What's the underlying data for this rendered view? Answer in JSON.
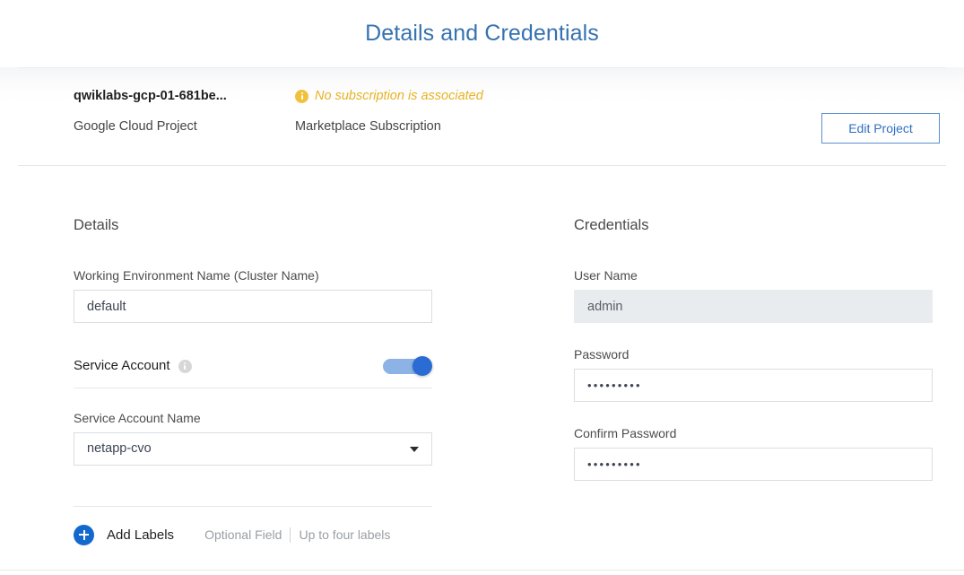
{
  "page": {
    "title": "Details and Credentials"
  },
  "project_band": {
    "project_name": "qwiklabs-gcp-01-681be...",
    "project_caption": "Google Cloud Project",
    "subscription_warning": "No subscription is associated",
    "subscription_caption": "Marketplace Subscription",
    "warning_icon": "info-icon",
    "edit_button_label": "Edit Project",
    "warning_color": "#e8b224",
    "accent_color": "#2f6fc0"
  },
  "details": {
    "section_title": "Details",
    "working_env": {
      "label": "Working Environment Name (Cluster Name)",
      "value": "default",
      "placeholder": ""
    },
    "service_account": {
      "label": "Service Account",
      "info_icon": "info-icon",
      "toggle_state": "on"
    },
    "service_account_name": {
      "label": "Service Account Name",
      "value": "netapp-cvo",
      "caret_icon": "chevron-down-icon"
    },
    "labels": {
      "add_icon": "plus-circle-icon",
      "add_label": "Add Labels",
      "hint_optional": "Optional Field",
      "hint_max": "Up to four labels"
    }
  },
  "credentials": {
    "section_title": "Credentials",
    "user_name": {
      "label": "User Name",
      "value": "admin",
      "disabled": true
    },
    "password": {
      "label": "Password",
      "value": "•••••••••"
    },
    "confirm_password": {
      "label": "Confirm Password",
      "value": "•••••••••"
    }
  }
}
